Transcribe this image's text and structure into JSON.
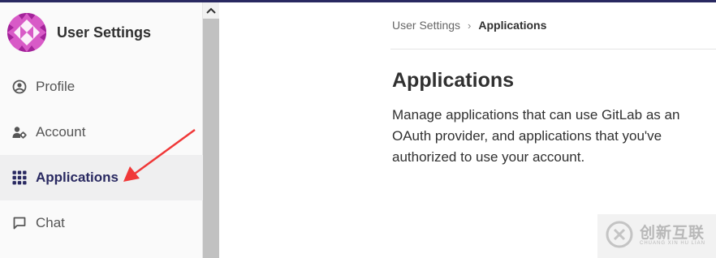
{
  "sidebar": {
    "title": "User Settings",
    "items": [
      {
        "label": "Profile",
        "icon": "profile-icon"
      },
      {
        "label": "Account",
        "icon": "account-icon"
      },
      {
        "label": "Applications",
        "icon": "applications-icon",
        "active": true
      },
      {
        "label": "Chat",
        "icon": "chat-icon"
      }
    ]
  },
  "breadcrumb": {
    "parent": "User Settings",
    "separator": "›",
    "current": "Applications"
  },
  "main": {
    "title": "Applications",
    "description": "Manage applications that can use GitLab as an OAuth provider, and applications that you've authorized to use your account."
  },
  "watermark": {
    "title": "创新互联",
    "subtitle": "CHUANG XIN HU LIAN"
  },
  "colors": {
    "accent": "#292961",
    "arrow": "#f03838",
    "avatar": "#d85ac7"
  }
}
